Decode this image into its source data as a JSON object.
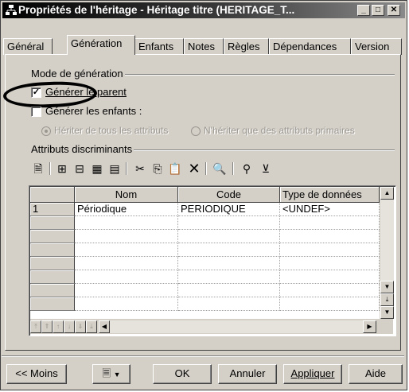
{
  "window": {
    "title": "Propriétés de l'héritage - Héritage titre (HERITAGE_T..."
  },
  "tabs": [
    {
      "label": "Général"
    },
    {
      "label": "Génération"
    },
    {
      "label": "Enfants"
    },
    {
      "label": "Notes"
    },
    {
      "label": "Règles"
    },
    {
      "label": "Dépendances"
    },
    {
      "label": "Version"
    }
  ],
  "generation": {
    "mode_group_label": "Mode de génération",
    "gen_parent_label": "Générer le parent",
    "gen_parent_checked": true,
    "gen_children_label": "Générer les enfants :",
    "gen_children_checked": false,
    "inherit_all_label": "Hériter de tous les attributs",
    "inherit_primary_label": "N'hériter que des attributs primaires",
    "attrs_group_label": "Attributs discriminants"
  },
  "grid": {
    "headers": [
      "",
      "Nom",
      "Code",
      "Type de données"
    ],
    "rows": [
      {
        "num": "1",
        "nom": "Périodique",
        "code": "PERIODIQUE",
        "type": "<UNDEF>"
      }
    ]
  },
  "buttons": {
    "less": "<< Moins",
    "ok": "OK",
    "cancel": "Annuler",
    "apply": "Appliquer",
    "help": "Aide"
  }
}
